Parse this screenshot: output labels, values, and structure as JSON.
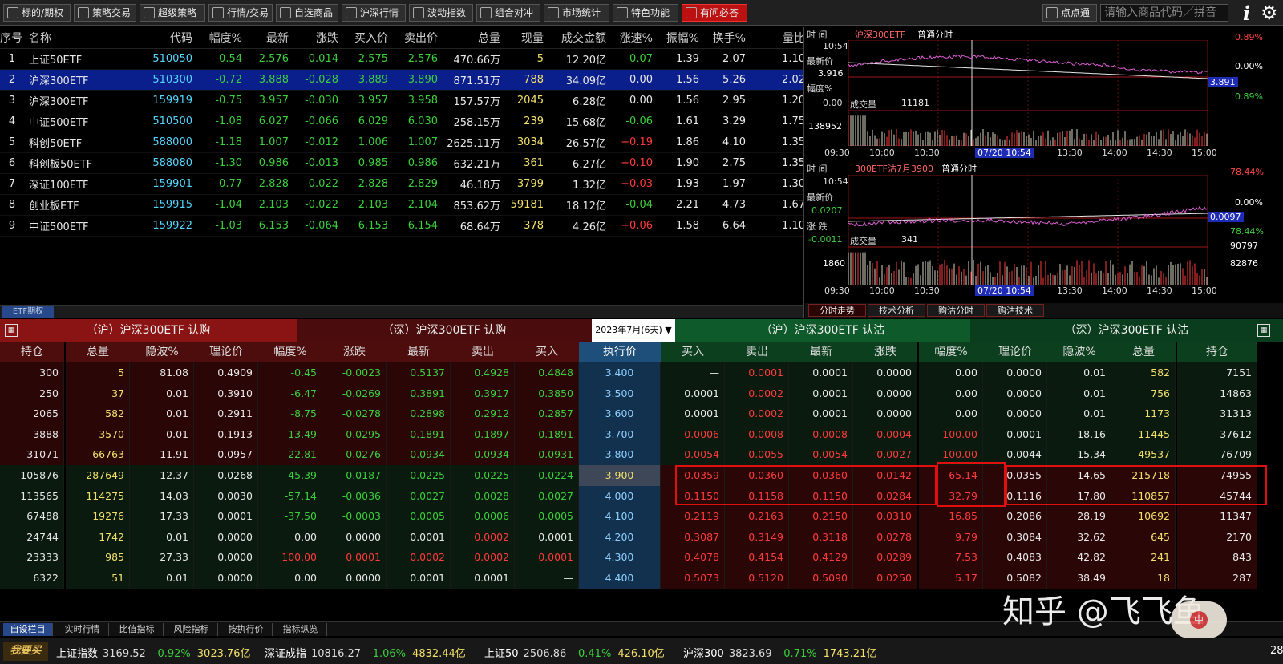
{
  "toolbar": {
    "buttons": [
      "标的/期权",
      "策略交易",
      "超级策略",
      "行情/交易",
      "自选商品",
      "沪深行情",
      "波动指数",
      "组合对冲",
      "市场统计",
      "特色功能",
      "有问必答"
    ],
    "quick_label": "点点通",
    "search_placeholder": "请输入商品代码／拼音"
  },
  "price_table": {
    "headers": [
      "序号",
      "名称",
      "代码",
      "幅度%",
      "最新",
      "涨跌",
      "买入价",
      "卖出价",
      "总量",
      "现量",
      "成交金额",
      "涨速%",
      "振幅%",
      "换手%",
      "量比"
    ],
    "rows": [
      [
        "1",
        "上证50ETF",
        "510050",
        "-0.54",
        "2.576",
        "-0.014",
        "2.575",
        "2.576",
        "470.66万",
        "5",
        "12.20亿",
        "-0.07",
        "1.39",
        "2.07",
        "1.10"
      ],
      [
        "2",
        "沪深300ETF",
        "510300",
        "-0.72",
        "3.888",
        "-0.028",
        "3.889",
        "3.890",
        "871.51万",
        "788",
        "34.09亿",
        "0.00",
        "1.56",
        "5.26",
        "2.02"
      ],
      [
        "3",
        "沪深300ETF",
        "159919",
        "-0.75",
        "3.957",
        "-0.030",
        "3.957",
        "3.958",
        "157.57万",
        "2045",
        "6.28亿",
        "0.00",
        "1.56",
        "2.95",
        "1.20"
      ],
      [
        "4",
        "中证500ETF",
        "510500",
        "-1.08",
        "6.027",
        "-0.066",
        "6.029",
        "6.030",
        "258.15万",
        "239",
        "15.68亿",
        "-0.06",
        "1.61",
        "3.29",
        "1.75"
      ],
      [
        "5",
        "科创50ETF",
        "588000",
        "-1.18",
        "1.007",
        "-0.012",
        "1.006",
        "1.007",
        "2625.11万",
        "3034",
        "26.57亿",
        "+0.19",
        "1.86",
        "4.10",
        "1.35"
      ],
      [
        "6",
        "科创板50ETF",
        "588080",
        "-1.30",
        "0.986",
        "-0.013",
        "0.985",
        "0.986",
        "632.21万",
        "361",
        "6.27亿",
        "+0.10",
        "1.90",
        "2.75",
        "1.35"
      ],
      [
        "7",
        "深证100ETF",
        "159901",
        "-0.77",
        "2.828",
        "-0.022",
        "2.828",
        "2.829",
        "46.18万",
        "3799",
        "1.32亿",
        "+0.03",
        "1.93",
        "1.97",
        "1.30"
      ],
      [
        "8",
        "创业板ETF",
        "159915",
        "-1.04",
        "2.103",
        "-0.022",
        "2.103",
        "2.104",
        "853.62万",
        "59181",
        "18.12亿",
        "-0.04",
        "2.21",
        "4.73",
        "1.67"
      ],
      [
        "9",
        "中证500ETF",
        "159922",
        "-1.03",
        "6.153",
        "-0.064",
        "6.153",
        "6.154",
        "68.64万",
        "378",
        "4.26亿",
        "+0.06",
        "1.58",
        "6.64",
        "1.10"
      ]
    ],
    "selected_row": 1,
    "tab_label": "ETF期权"
  },
  "chart_top": {
    "time_label": "时  间",
    "time": "10:54",
    "symbol": "沪深300ETF",
    "mode": "普通分时",
    "price_label": "最新价",
    "price": "3.916",
    "pct_label": "幅度%",
    "pct": "0.00",
    "right_labels": [
      "0.89%",
      "0.00%",
      "3.891",
      "0.89%"
    ],
    "vol_label": "成交量",
    "vol_now": "11181",
    "vol_max": "138952",
    "x_ticks": [
      "09:30",
      "10:00",
      "10:30",
      "07/20 10:54",
      "13:30",
      "14:00",
      "14:30",
      "15:00"
    ]
  },
  "chart_bottom": {
    "time_label": "时  间",
    "time": "10:54",
    "symbol": "300ETF沽7月3900",
    "mode": "普通分时",
    "price_label": "最新价",
    "price": "0.0207",
    "chg_label": "涨  跌",
    "chg": "-0.0011",
    "right_labels": [
      "78.44%",
      "0.00%",
      "0.0097",
      "78.44%"
    ],
    "vol_label": "成交量",
    "vol_now": "341",
    "vol_max": "1860",
    "vol_right": [
      "90797",
      "82876"
    ],
    "x_ticks": [
      "09:30",
      "10:00",
      "10:30",
      "07/20 10:54",
      "13:30",
      "14:00",
      "14:30",
      "15:00"
    ]
  },
  "chart_tabs": [
    "分时走势",
    "技术分析",
    "购沽分时",
    "购沽技术"
  ],
  "options": {
    "band_left1": "（沪）沪深300ETF 认购",
    "band_left2": "（深）沪深300ETF 认购",
    "month": "2023年7月(6天)",
    "band_right1": "（沪）沪深300ETF 认沽",
    "band_right2": "（深）沪深300ETF 认沽",
    "call_headers": [
      "持仓",
      "总量",
      "隐波%",
      "理论价",
      "幅度%",
      "涨跌",
      "最新",
      "卖出",
      "买入"
    ],
    "strike_header": "执行价",
    "put_headers": [
      "买入",
      "卖出",
      "最新",
      "涨跌",
      "幅度%",
      "理论价",
      "隐波%",
      "总量",
      "持仓"
    ],
    "rows": [
      {
        "call": [
          "300",
          "5",
          "81.08",
          "0.4909",
          "-0.45",
          "-0.0023",
          "0.5137",
          "0.4928",
          "0.4848"
        ],
        "strike": "3.400",
        "put": [
          "—",
          "0.0001",
          "0.0001",
          "0.0000",
          "0.00",
          "0.0000",
          "0.01",
          "582",
          "7151"
        ]
      },
      {
        "call": [
          "250",
          "37",
          "0.01",
          "0.3910",
          "-6.47",
          "-0.0269",
          "0.3891",
          "0.3917",
          "0.3850"
        ],
        "strike": "3.500",
        "put": [
          "0.0001",
          "0.0002",
          "0.0001",
          "0.0000",
          "0.00",
          "0.0000",
          "0.01",
          "756",
          "14863"
        ]
      },
      {
        "call": [
          "2065",
          "582",
          "0.01",
          "0.2911",
          "-8.75",
          "-0.0278",
          "0.2898",
          "0.2912",
          "0.2857"
        ],
        "strike": "3.600",
        "put": [
          "0.0001",
          "0.0002",
          "0.0001",
          "0.0000",
          "0.00",
          "0.0000",
          "0.01",
          "1173",
          "31313"
        ]
      },
      {
        "call": [
          "3888",
          "3570",
          "0.01",
          "0.1913",
          "-13.49",
          "-0.0295",
          "0.1891",
          "0.1897",
          "0.1891"
        ],
        "strike": "3.700",
        "put": [
          "0.0006",
          "0.0008",
          "0.0008",
          "0.0004",
          "100.00",
          "0.0001",
          "18.16",
          "11445",
          "37612"
        ]
      },
      {
        "call": [
          "31071",
          "66763",
          "11.91",
          "0.0957",
          "-22.81",
          "-0.0276",
          "0.0934",
          "0.0934",
          "0.0931"
        ],
        "strike": "3.800",
        "put": [
          "0.0054",
          "0.0055",
          "0.0054",
          "0.0027",
          "100.00",
          "0.0044",
          "15.34",
          "49537",
          "76709"
        ]
      },
      {
        "call": [
          "105876",
          "287649",
          "12.37",
          "0.0268",
          "-45.39",
          "-0.0187",
          "0.0225",
          "0.0225",
          "0.0224"
        ],
        "strike": "3.900",
        "put": [
          "0.0359",
          "0.0360",
          "0.0360",
          "0.0142",
          "65.14",
          "0.0355",
          "14.65",
          "215718",
          "74955"
        ]
      },
      {
        "call": [
          "113565",
          "114275",
          "14.03",
          "0.0030",
          "-57.14",
          "-0.0036",
          "0.0027",
          "0.0028",
          "0.0027"
        ],
        "strike": "4.000",
        "put": [
          "0.1150",
          "0.1158",
          "0.1150",
          "0.0284",
          "32.79",
          "0.1116",
          "17.80",
          "110857",
          "45744"
        ]
      },
      {
        "call": [
          "67488",
          "19276",
          "17.33",
          "0.0001",
          "-37.50",
          "-0.0003",
          "0.0005",
          "0.0006",
          "0.0005"
        ],
        "strike": "4.100",
        "put": [
          "0.2119",
          "0.2163",
          "0.2150",
          "0.0310",
          "16.85",
          "0.2086",
          "28.19",
          "10692",
          "11347"
        ]
      },
      {
        "call": [
          "24744",
          "1742",
          "0.01",
          "0.0000",
          "0.00",
          "0.0000",
          "0.0001",
          "0.0002",
          "0.0001"
        ],
        "strike": "4.200",
        "put": [
          "0.3087",
          "0.3149",
          "0.3118",
          "0.0278",
          "9.79",
          "0.3084",
          "32.62",
          "645",
          "2170"
        ]
      },
      {
        "call": [
          "23333",
          "985",
          "27.33",
          "0.0000",
          "100.00",
          "0.0001",
          "0.0002",
          "0.0002",
          "0.0001"
        ],
        "strike": "4.300",
        "put": [
          "0.4078",
          "0.4154",
          "0.4129",
          "0.0289",
          "7.53",
          "0.4083",
          "42.82",
          "241",
          "843"
        ]
      },
      {
        "call": [
          "6322",
          "51",
          "0.01",
          "0.0000",
          "0.00",
          "0.0000",
          "0.0001",
          "0.0001",
          "—"
        ],
        "strike": "4.400",
        "put": [
          "0.5073",
          "0.5120",
          "0.5090",
          "0.0250",
          "5.17",
          "0.5082",
          "38.49",
          "18",
          "287"
        ]
      }
    ]
  },
  "bottom_tabs": [
    "自设栏目",
    "实时行情",
    "比值指标",
    "风险指标",
    "按执行价",
    "指标纵览"
  ],
  "ticker": [
    {
      "name": "上证指数",
      "value": "3169.52",
      "pct": "-0.92%",
      "amt": "3023.76亿"
    },
    {
      "name": "深证成指",
      "value": "10816.27",
      "pct": "-1.06%",
      "amt": "4832.44亿"
    },
    {
      "name": "上证50",
      "value": "2506.86",
      "pct": "-0.41%",
      "amt": "426.10亿"
    },
    {
      "name": "沪深300",
      "value": "3823.69",
      "pct": "-0.71%",
      "amt": "1743.21亿"
    }
  ],
  "ticker_logo": "我要买",
  "ticker_clock": "28",
  "watermark": "知乎 @飞飞鱼",
  "watermark_logo": "中",
  "colors": {
    "up": "#ff3b3b",
    "down": "#3ccf3c",
    "call_band": "#8a1414",
    "put_band": "#0f5a2a",
    "strike_bg": "#12314f",
    "highlight": "#e01010"
  }
}
